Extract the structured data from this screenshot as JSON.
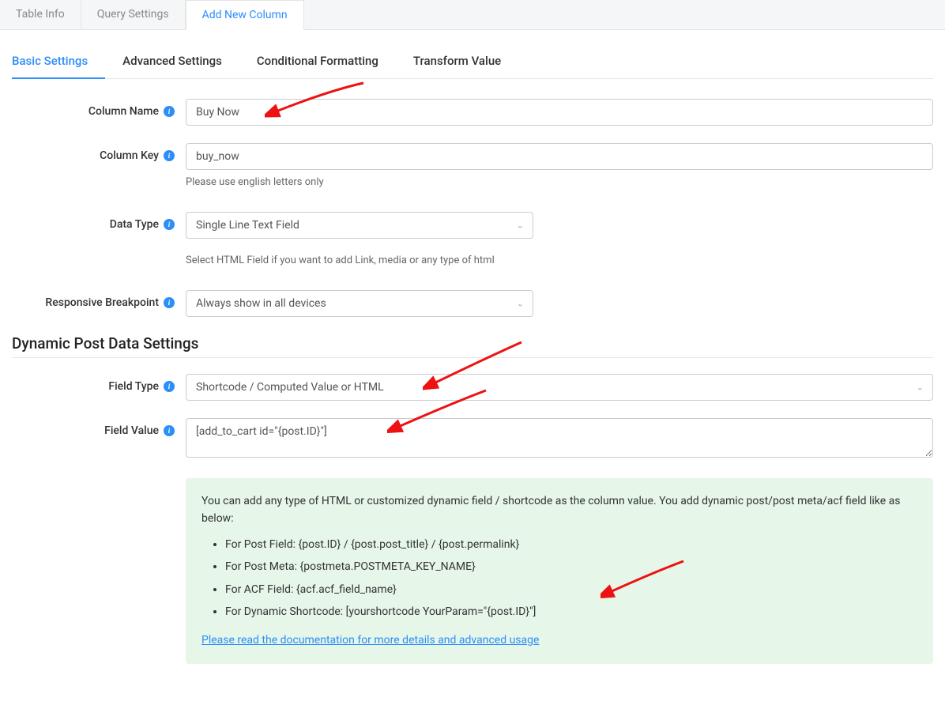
{
  "topTabs": {
    "tableInfo": "Table Info",
    "querySettings": "Query Settings",
    "addNewColumn": "Add New Column"
  },
  "subTabs": {
    "basic": "Basic Settings",
    "advanced": "Advanced Settings",
    "conditional": "Conditional Formatting",
    "transform": "Transform Value"
  },
  "labels": {
    "columnName": "Column Name",
    "columnKey": "Column Key",
    "dataType": "Data Type",
    "responsiveBreakpoint": "Responsive Breakpoint",
    "fieldType": "Field Type",
    "fieldValue": "Field Value"
  },
  "values": {
    "columnName": "Buy Now",
    "columnKey": "buy_now",
    "dataType": "Single Line Text Field",
    "responsiveBreakpoint": "Always show in all devices",
    "fieldType": "Shortcode / Computed Value or HTML",
    "fieldValue": "[add_to_cart id=\"{post.ID}\"]"
  },
  "help": {
    "columnKey": "Please use english letters only",
    "dataType": "Select HTML Field if you want to add Link, media or any type of html"
  },
  "sectionHeading": "Dynamic Post Data Settings",
  "notice": {
    "intro": "You can add any type of HTML or customized dynamic field / shortcode as the column value. You add dynamic post/post meta/acf field like as below:",
    "items": [
      "For Post Field: {post.ID} / {post.post_title} / {post.permalink}",
      "For Post Meta: {postmeta.POSTMETA_KEY_NAME}",
      "For ACF Field: {acf.acf_field_name}",
      "For Dynamic Shortcode: [yourshortcode YourParam=\"{post.ID}\"]"
    ],
    "link": "Please read the documentation for more details and advanced usage"
  }
}
